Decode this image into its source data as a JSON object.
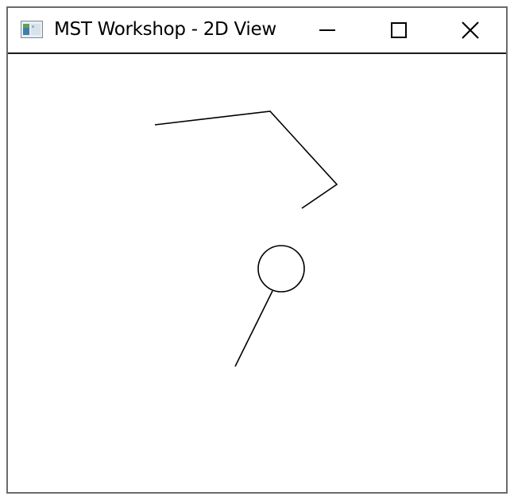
{
  "window": {
    "title": "MST Workshop - 2D View",
    "app_icon": "window-app-icon",
    "controls": {
      "minimize_icon": "minimize-icon",
      "maximize_icon": "maximize-icon",
      "close_icon": "close-icon"
    }
  },
  "canvas": {
    "background_color": "#ffffff",
    "stroke_color": "#000000"
  }
}
